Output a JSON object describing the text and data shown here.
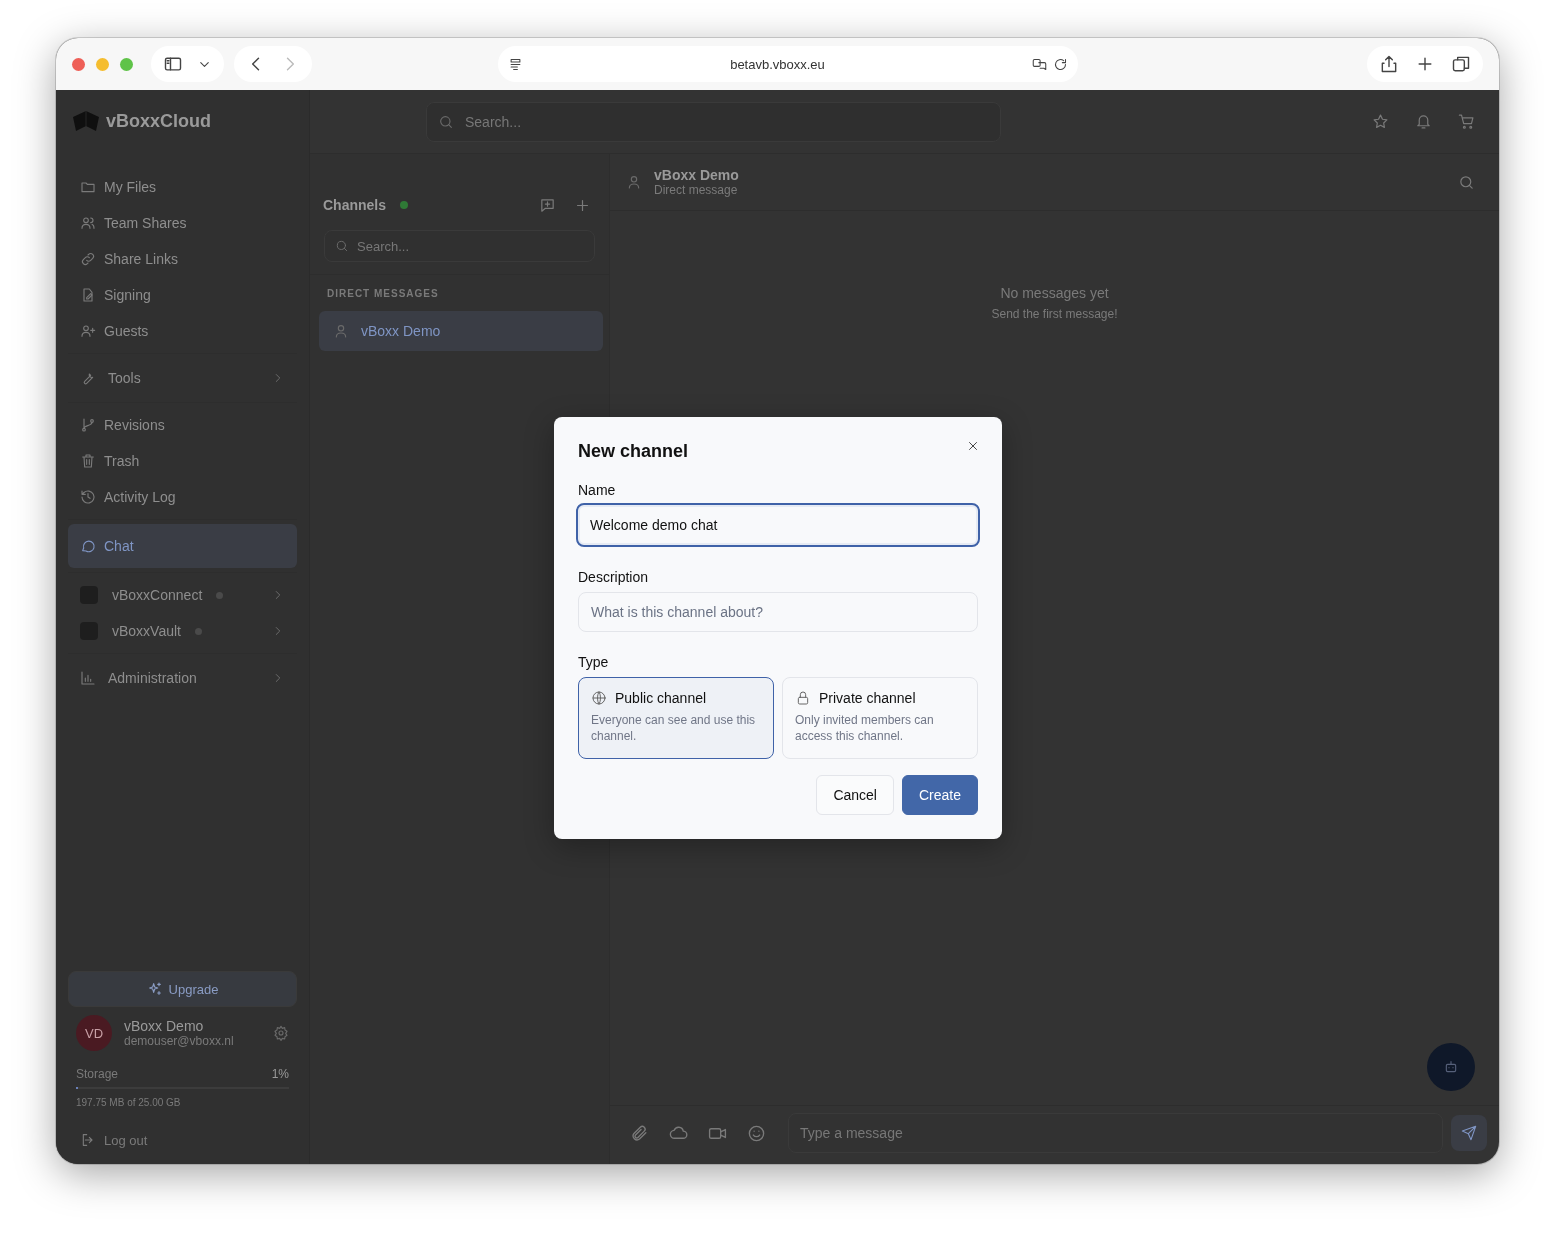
{
  "browser": {
    "url": "betavb.vboxx.eu"
  },
  "app": {
    "logo": "vBoxxCloud",
    "search_placeholder": "Search..."
  },
  "sidebar": {
    "groups": [
      [
        {
          "label": "My Files",
          "kind": "link",
          "selected": false
        },
        {
          "label": "Team Shares",
          "kind": "link",
          "selected": false
        },
        {
          "label": "Share Links",
          "kind": "link",
          "selected": false
        },
        {
          "label": "Signing",
          "kind": "link",
          "selected": false
        },
        {
          "label": "Guests",
          "kind": "link",
          "selected": false
        }
      ],
      [
        {
          "label": "Tools",
          "kind": "expander",
          "selected": false
        }
      ],
      [
        {
          "label": "Revisions",
          "kind": "link",
          "selected": false
        },
        {
          "label": "Trash",
          "kind": "link",
          "selected": false
        },
        {
          "label": "Activity Log",
          "kind": "link",
          "selected": false
        }
      ],
      [
        {
          "label": "Chat",
          "kind": "link",
          "selected": true
        }
      ],
      [
        {
          "label": "vBoxxConnect",
          "kind": "app",
          "selected": false
        },
        {
          "label": "vBoxxVault",
          "kind": "app",
          "selected": false
        }
      ],
      [
        {
          "label": "Administration",
          "kind": "expander",
          "selected": false
        }
      ]
    ],
    "upgrade": "Upgrade",
    "user": {
      "initials": "VD",
      "name": "vBoxx Demo",
      "email": "demouser@vboxx.nl"
    },
    "storage": {
      "label": "Storage",
      "percent": "1%",
      "level": 0.01,
      "detail": "197.75 MB of 25.00 GB"
    },
    "logout": "Log out"
  },
  "channels": {
    "title": "Channels",
    "online": true,
    "search_placeholder": "Search...",
    "section": "DIRECT MESSAGES",
    "items": [
      {
        "name": "vBoxx Demo",
        "selected": true
      }
    ]
  },
  "chat": {
    "name": "vBoxx Demo",
    "subtitle": "Direct message",
    "empty_title": "No messages yet",
    "empty_subtitle": "Send the first message!",
    "composer_placeholder": "Type a message"
  },
  "dialog": {
    "title": "New channel",
    "name_label": "Name",
    "name_value": "Welcome demo chat",
    "description_label": "Description",
    "description_placeholder": "What is this channel about?",
    "type_label": "Type",
    "options": [
      {
        "title": "Public channel",
        "description": "Everyone can see and use this channel.",
        "selected": true
      },
      {
        "title": "Private channel",
        "description": "Only invited members can access this channel.",
        "selected": false
      }
    ],
    "buttons": [
      {
        "label": "Cancel",
        "kind": "secondary"
      },
      {
        "label": "Create",
        "kind": "primary"
      }
    ]
  }
}
